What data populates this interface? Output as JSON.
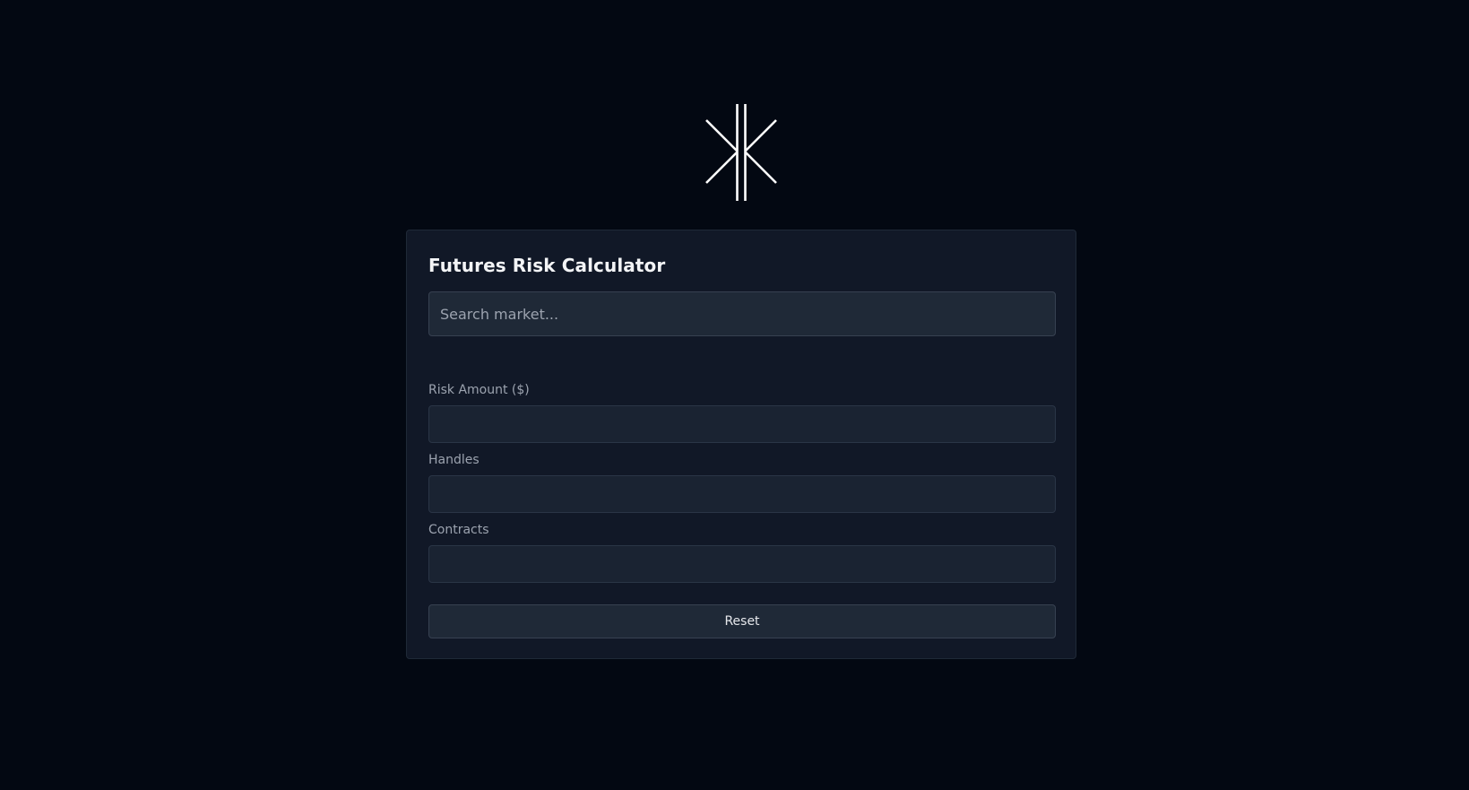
{
  "brand": {
    "logo_icon": "x-with-double-vertical-bars-logo",
    "logo_color": "#ffffff"
  },
  "calculator": {
    "title": "Futures Risk Calculator",
    "search": {
      "placeholder": "Search market...",
      "value": ""
    },
    "fields": [
      {
        "label": "Risk Amount ($)",
        "value": ""
      },
      {
        "label": "Handles",
        "value": ""
      },
      {
        "label": "Contracts",
        "value": ""
      }
    ],
    "reset_label": "Reset"
  },
  "colors": {
    "page_background": "#030812",
    "card_background": "#111827",
    "input_background": "#1a2332",
    "label_text": "#9ca3af",
    "title_text": "#f3f4f6"
  }
}
